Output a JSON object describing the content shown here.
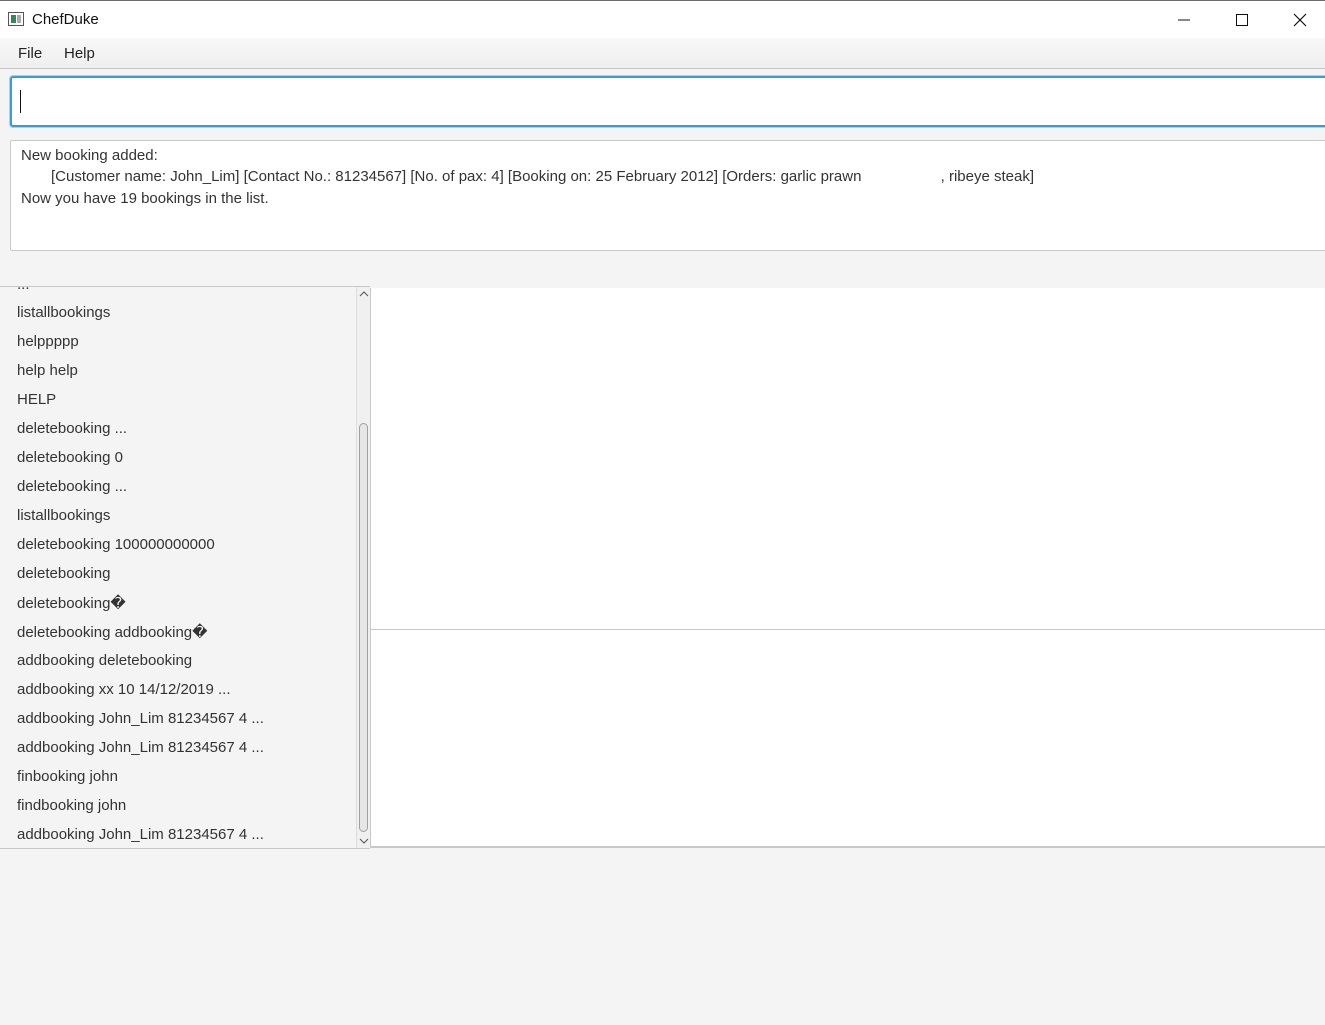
{
  "window": {
    "title": "ChefDuke",
    "icon": "app-icon",
    "controls": [
      "minimize-icon",
      "maximize-icon",
      "close-icon"
    ]
  },
  "menu": {
    "file": "File",
    "help": "Help"
  },
  "command_input": {
    "value": ""
  },
  "result": {
    "line1": "New booking added:",
    "line2": "[Customer name: John_Lim] [Contact No.: 81234567] [No. of pax: 4] [Booking on: 25 February 2012] [Orders: garlic prawn                   , ribeye steak]",
    "line3": "Now you have 19 bookings in the list."
  },
  "history": {
    "partial_top": "...",
    "items": [
      "listallbookings",
      "helppppp",
      "help help",
      "HELP",
      "deletebooking ...",
      "deletebooking 0",
      "deletebooking ...",
      "listallbookings",
      "deletebooking 100000000000",
      "deletebooking",
      "deletebooking�",
      "deletebooking addbooking�",
      "addbooking deletebooking",
      "addbooking xx 10 14/12/2019 ...",
      "addbooking John_Lim 81234567 4 ...",
      "addbooking John_Lim 81234567 4 ...",
      "finbooking john",
      "findbooking john",
      "addbooking John_Lim 81234567 4 ..."
    ]
  }
}
